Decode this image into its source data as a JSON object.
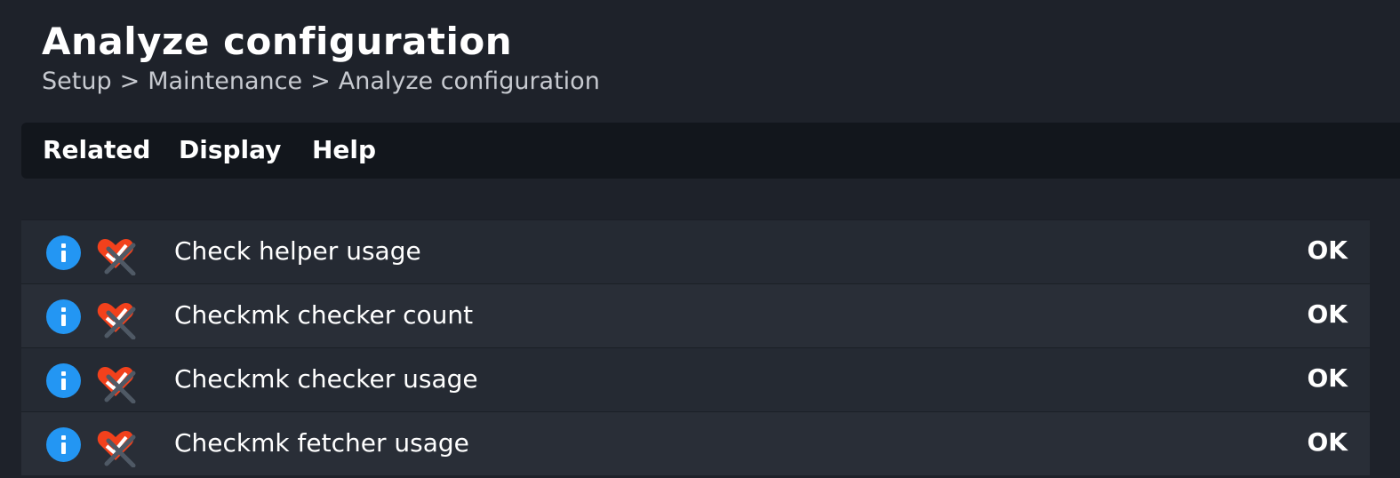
{
  "page": {
    "title": "Analyze configuration",
    "breadcrumb": [
      "Setup",
      "Maintenance",
      "Analyze configuration"
    ],
    "breadcrumb_separator": ">"
  },
  "menu": {
    "items": [
      "Related",
      "Display",
      "Help"
    ]
  },
  "checks": [
    {
      "name": "Check helper usage",
      "state": "OK",
      "icons": [
        "info-icon",
        "acknowledge-icon"
      ]
    },
    {
      "name": "Checkmk checker count",
      "state": "OK",
      "icons": [
        "info-icon",
        "acknowledge-icon"
      ]
    },
    {
      "name": "Checkmk checker usage",
      "state": "OK",
      "icons": [
        "info-icon",
        "acknowledge-icon"
      ]
    },
    {
      "name": "Checkmk fetcher usage",
      "state": "OK",
      "icons": [
        "info-icon",
        "acknowledge-icon"
      ]
    }
  ],
  "colors": {
    "background": "#1e222a",
    "menubar": "#12161c",
    "info_blue": "#2396f3",
    "ack_red": "#f2411c"
  }
}
